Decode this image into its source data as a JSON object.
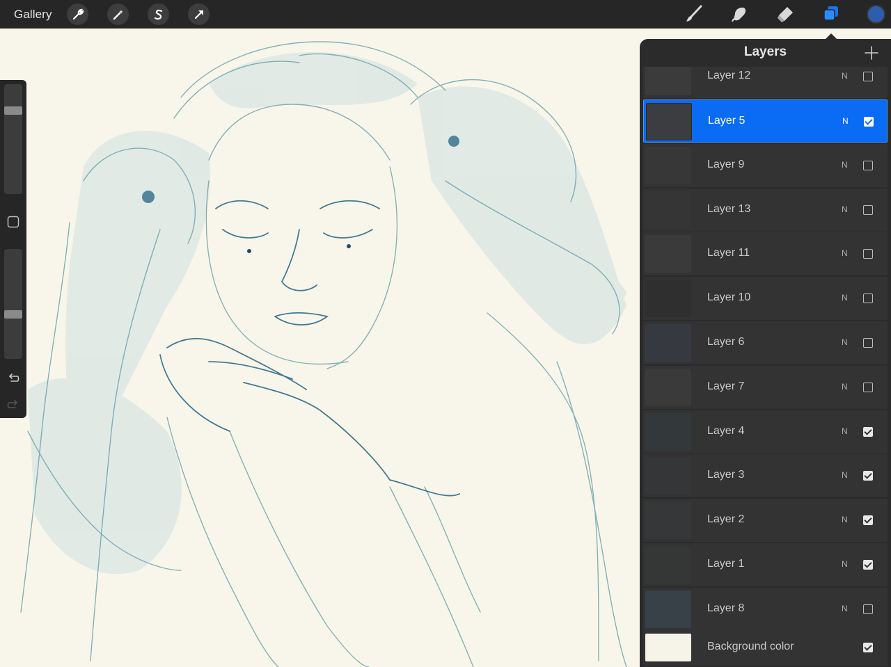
{
  "topbar": {
    "gallery_label": "Gallery",
    "left_tools": [
      {
        "name": "actions-wrench-icon"
      },
      {
        "name": "adjustments-magic-wand-icon"
      },
      {
        "name": "selection-icon"
      },
      {
        "name": "transform-arrow-icon"
      }
    ],
    "right_tools": [
      {
        "name": "brush-icon"
      },
      {
        "name": "smudge-icon"
      },
      {
        "name": "eraser-icon"
      },
      {
        "name": "layers-icon"
      }
    ],
    "current_color": "#2f5dae"
  },
  "sidebar": {
    "brush_size_level": 0.78,
    "opacity_level": 0.4
  },
  "layers_panel": {
    "title": "Layers",
    "add_icon": "plus-icon",
    "layers": [
      {
        "name": "Layer 12",
        "blend": "N",
        "visible": false,
        "active": false
      },
      {
        "name": "Layer 5",
        "blend": "N",
        "visible": true,
        "active": true
      },
      {
        "name": "Layer 9",
        "blend": "N",
        "visible": false,
        "active": false
      },
      {
        "name": "Layer 13",
        "blend": "N",
        "visible": false,
        "active": false
      },
      {
        "name": "Layer 11",
        "blend": "N",
        "visible": false,
        "active": false
      },
      {
        "name": "Layer 10",
        "blend": "N",
        "visible": false,
        "active": false
      },
      {
        "name": "Layer 6",
        "blend": "N",
        "visible": false,
        "active": false
      },
      {
        "name": "Layer 7",
        "blend": "N",
        "visible": false,
        "active": false
      },
      {
        "name": "Layer 4",
        "blend": "N",
        "visible": true,
        "active": false
      },
      {
        "name": "Layer 3",
        "blend": "N",
        "visible": true,
        "active": false
      },
      {
        "name": "Layer 2",
        "blend": "N",
        "visible": true,
        "active": false
      },
      {
        "name": "Layer 1",
        "blend": "N",
        "visible": true,
        "active": false
      },
      {
        "name": "Layer 8",
        "blend": "N",
        "visible": false,
        "active": false
      },
      {
        "name": "Background color",
        "blend": "",
        "visible": true,
        "active": false,
        "background": true
      }
    ]
  },
  "colors": {
    "accent": "#0a6cf5",
    "topbar": "#262626",
    "panel": "#2b2b2b",
    "canvas": "#f8f6ea",
    "sketch": "#5e9aa6"
  }
}
